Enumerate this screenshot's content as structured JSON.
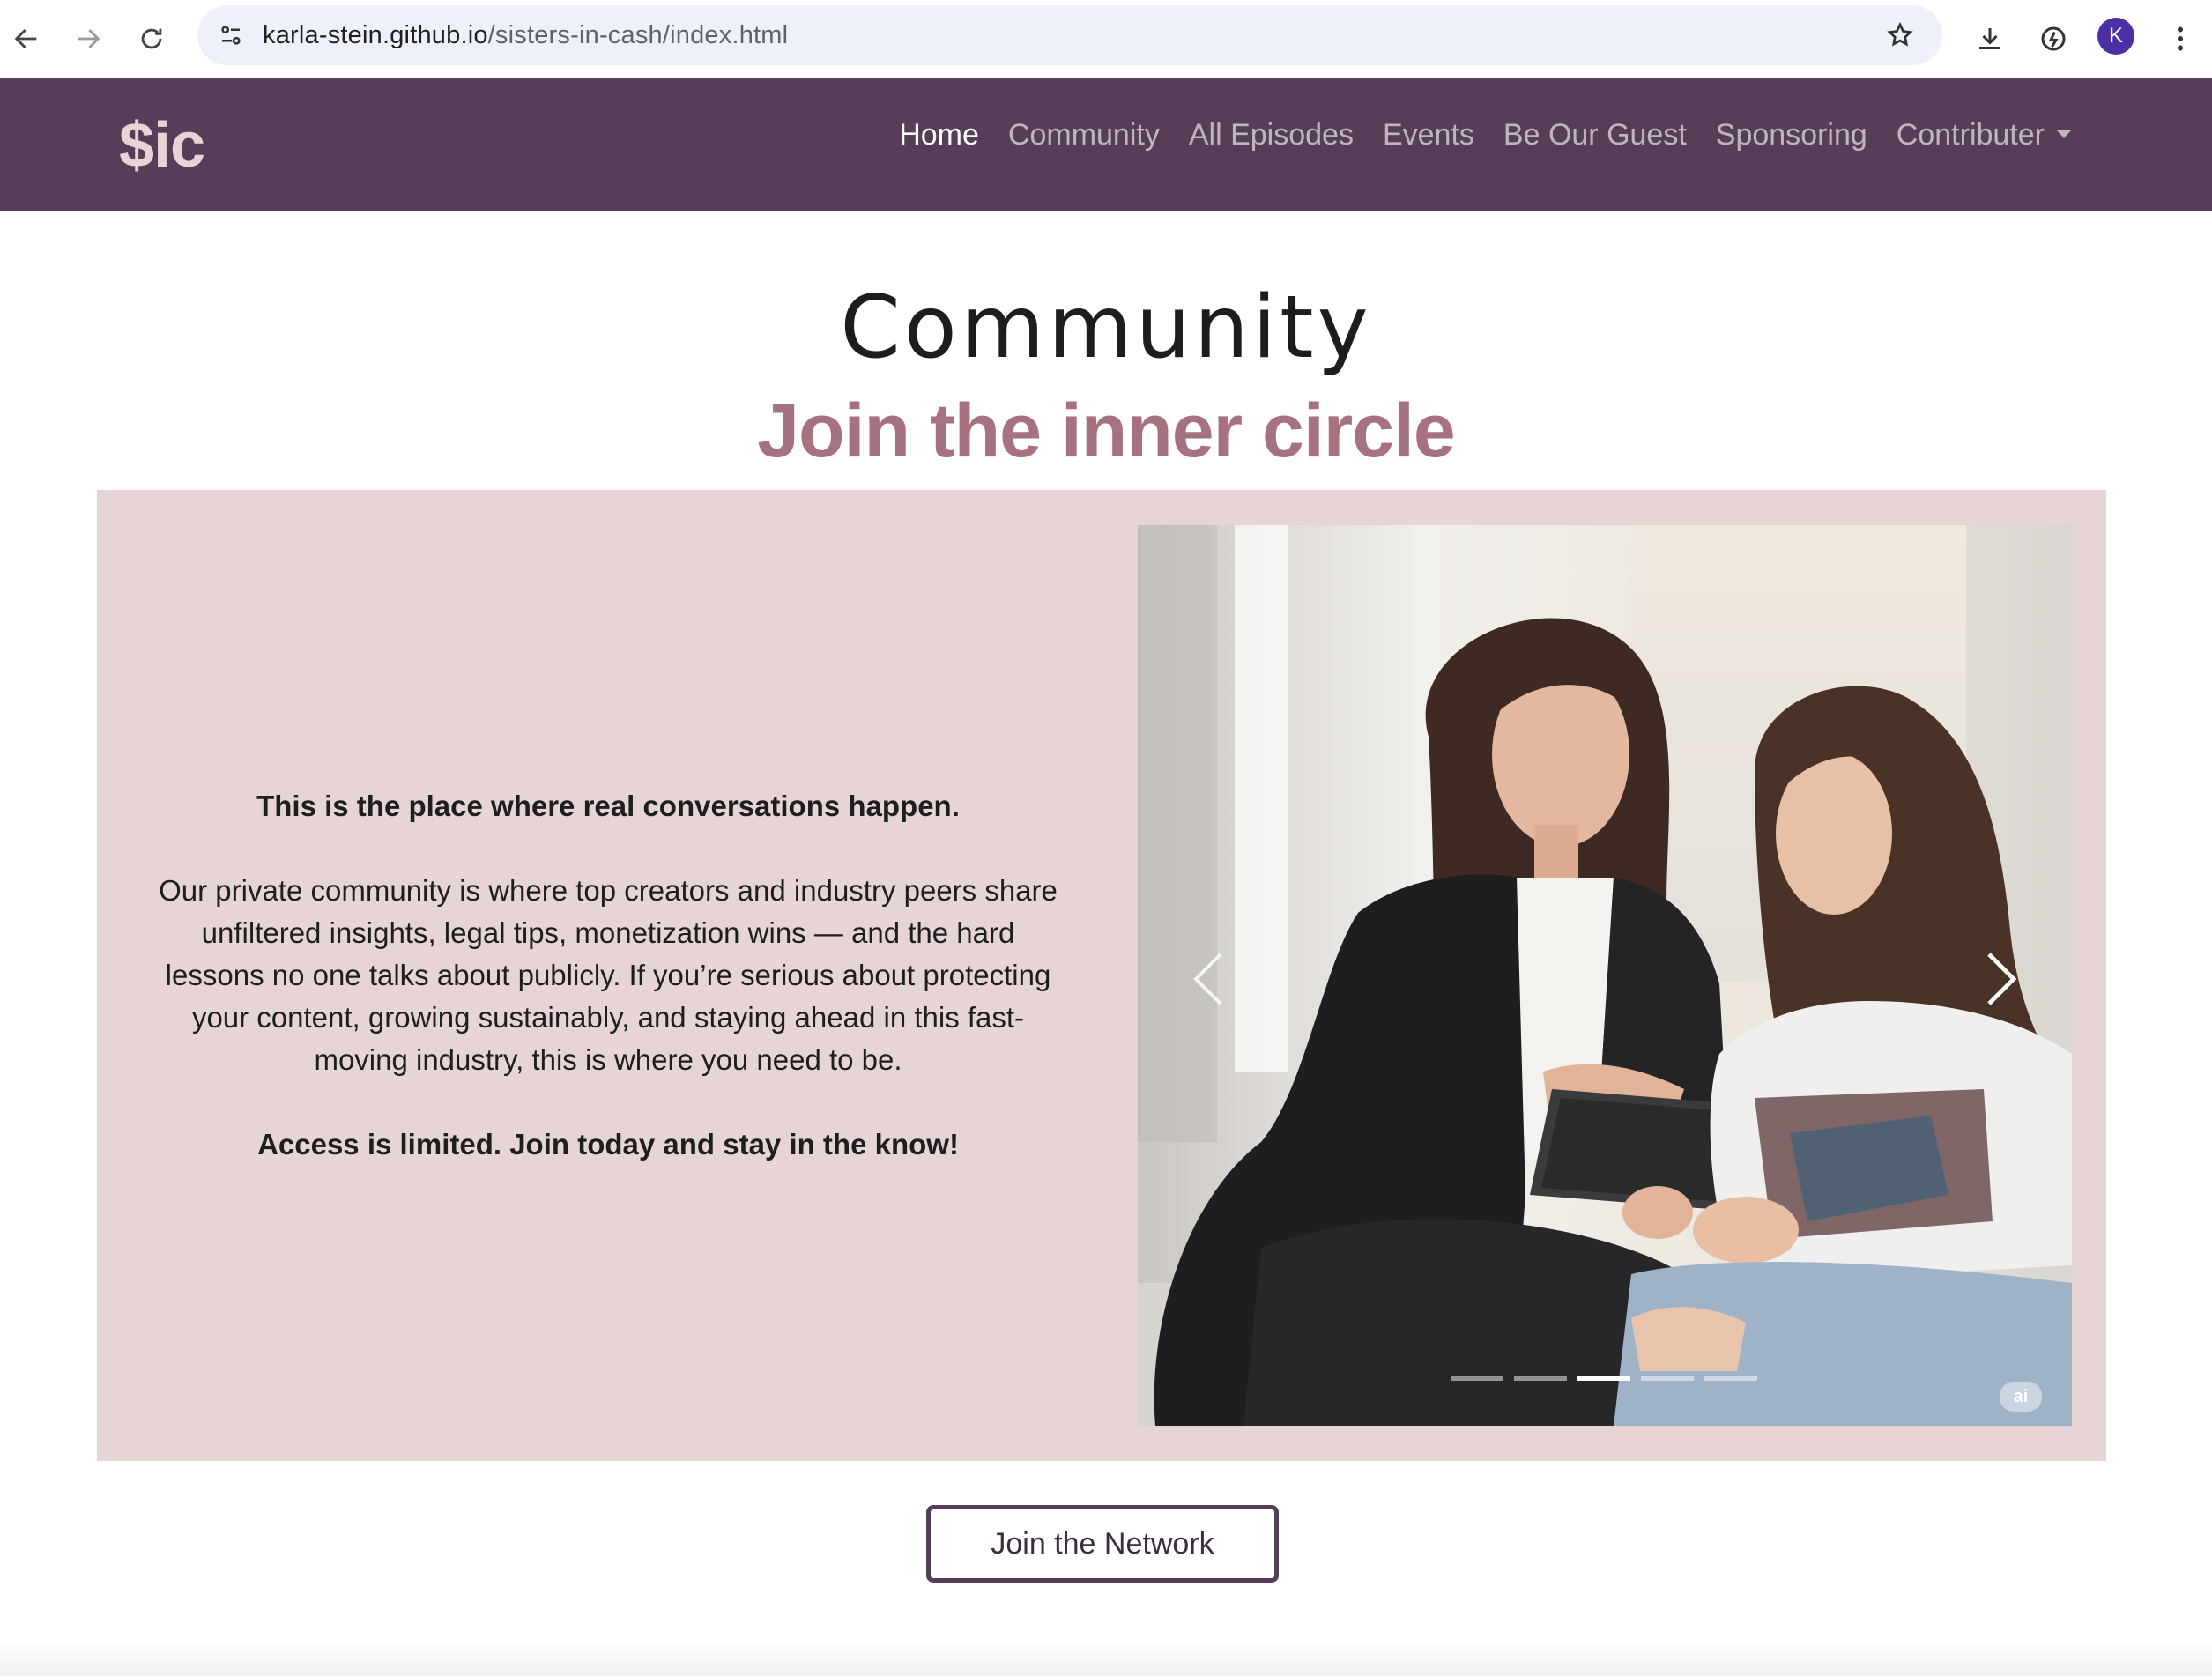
{
  "browser": {
    "url_domain": "karla-stein.github.io",
    "url_path": "/sisters-in-cash/index.html",
    "avatar_letter": "K"
  },
  "navbar": {
    "brand": "$ic",
    "links": [
      {
        "label": "Home",
        "active": true
      },
      {
        "label": "Community",
        "active": false
      },
      {
        "label": "All Episodes",
        "active": false
      },
      {
        "label": "Events",
        "active": false
      },
      {
        "label": "Be Our Guest",
        "active": false
      },
      {
        "label": "Sponsoring",
        "active": false
      },
      {
        "label": "Contributer",
        "active": false,
        "dropdown": true
      }
    ]
  },
  "section": {
    "title": "Community",
    "subtitle": "Join the inner circle",
    "intro_bold": "This is the place where real conversations happen.",
    "body": "Our private community is where top creators and industry peers share unfiltered insights, legal tips, monetization wins — and the hard lessons no one talks about publicly. If you’re serious about protecting your content, growing sustainably, and staying ahead in this fast-moving industry, this is where you need to be.",
    "closing_bold": "Access is limited. Join today and stay in the know!",
    "join_button": "Join the Network"
  },
  "carousel": {
    "slide_count": 5,
    "active_index": 2,
    "badge": "ai"
  },
  "colors": {
    "navbar_bg": "#573e58",
    "brand": "#e6d5d6",
    "subtitle": "#a7727f",
    "card_bg": "#e7d5d6",
    "button_border": "#573e58"
  }
}
